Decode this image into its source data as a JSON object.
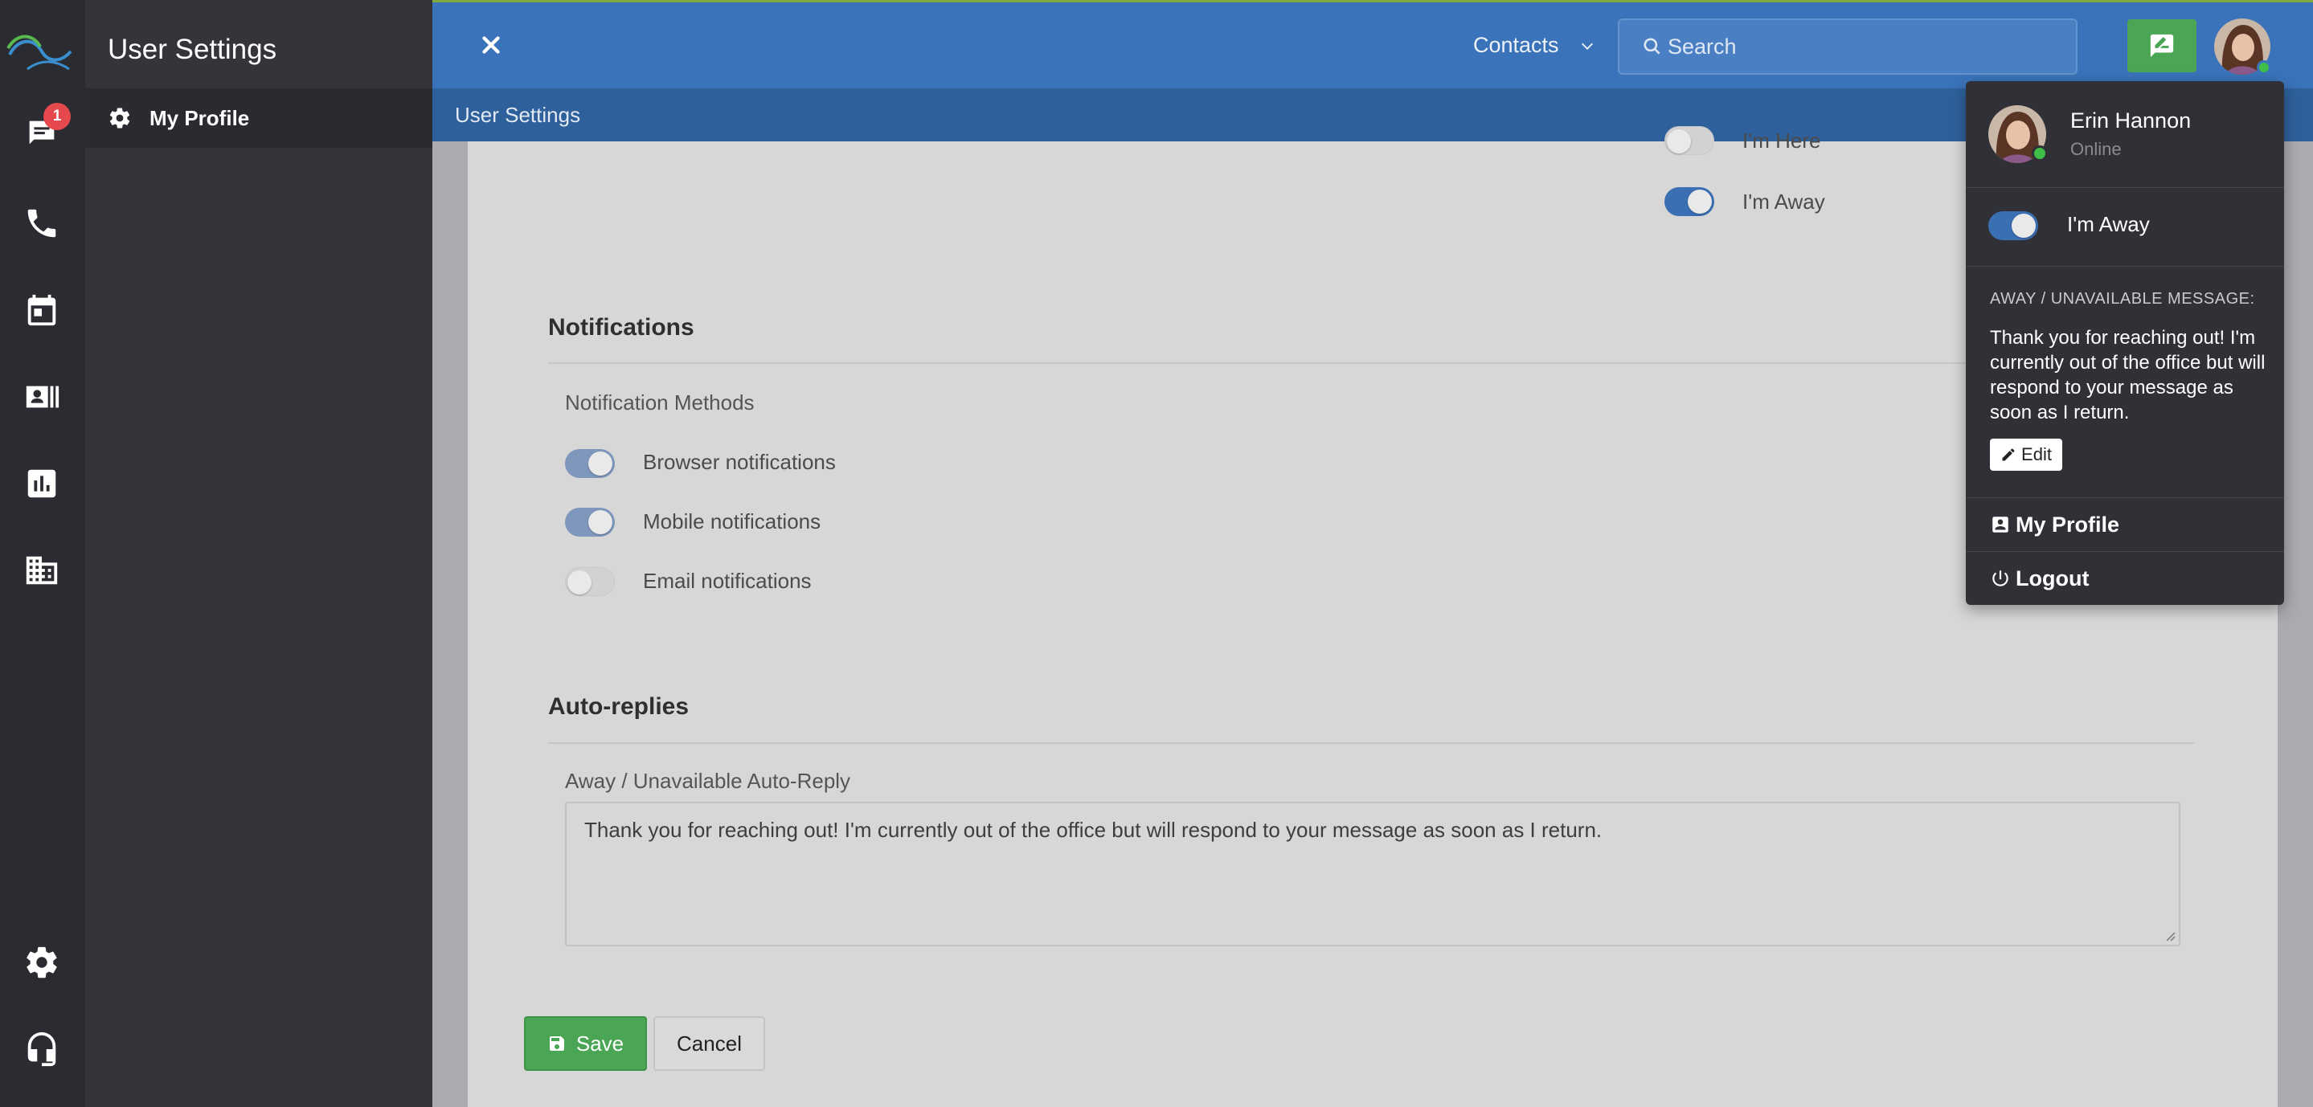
{
  "app": {
    "sidebar_title": "User Settings",
    "badge_count": "1",
    "accent": "#3a73ba",
    "success": "#4aa555"
  },
  "sidebar": {
    "items": [
      {
        "label": "My Profile",
        "icon": "gear-icon",
        "active": true
      }
    ]
  },
  "rail": {
    "icons": [
      "chat-icon",
      "phone-icon",
      "calendar-icon",
      "contacts-card-icon",
      "analytics-icon",
      "building-icon",
      "settings-gear-icon",
      "headset-icon"
    ]
  },
  "topbar": {
    "contacts_label": "Contacts",
    "search_placeholder": "Search",
    "breadcrumb": "User Settings"
  },
  "presence": {
    "here_label": "I'm Here",
    "away_label": "I'm Away",
    "here_on": false,
    "away_on": true
  },
  "notifications": {
    "title": "Notifications",
    "methods_label": "Notification Methods",
    "browser": {
      "label": "Browser notifications",
      "on": true
    },
    "mobile": {
      "label": "Mobile notifications",
      "on": true
    },
    "email": {
      "label": "Email notifications",
      "on": false
    }
  },
  "autoreplies": {
    "title": "Auto-replies",
    "field_label": "Away / Unavailable Auto-Reply",
    "value": "Thank you for reaching out! I'm currently out of the office but will respond to your message as soon as I return."
  },
  "actions": {
    "save": "Save",
    "cancel": "Cancel"
  },
  "user_menu": {
    "name": "Erin Hannon",
    "status": "Online",
    "away_toggle_label": "I'm Away",
    "away_on": true,
    "message_heading": "AWAY / UNAVAILABLE MESSAGE:",
    "message": "Thank you for reaching out! I'm currently out of the office but will respond to your message as soon as I return.",
    "edit_label": "Edit",
    "my_profile": "My Profile",
    "logout": "Logout"
  }
}
